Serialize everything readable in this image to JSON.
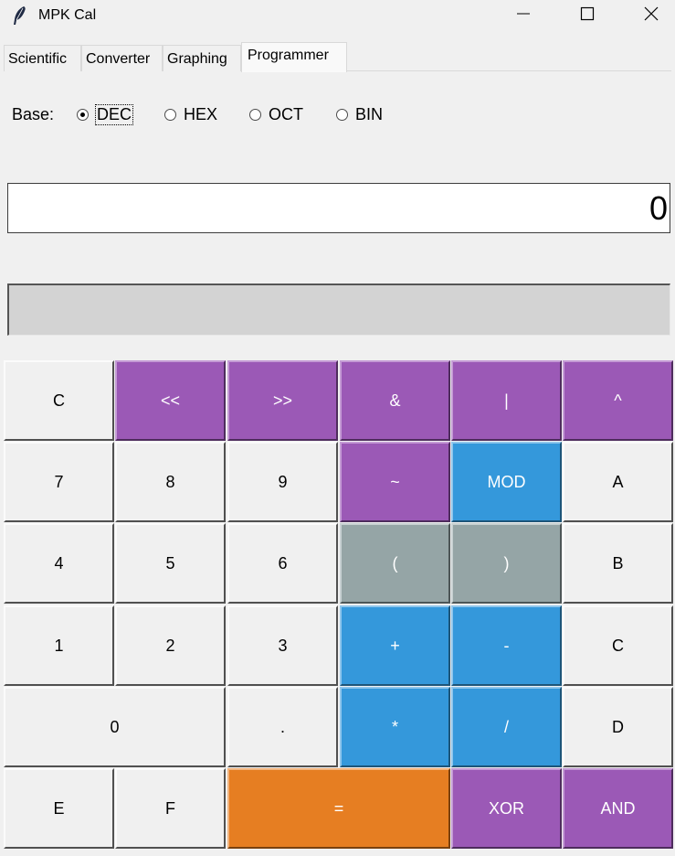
{
  "window": {
    "title": "MPK Cal",
    "icon": "feather-icon",
    "controls": [
      "minimize-icon",
      "maximize-icon",
      "close-icon"
    ]
  },
  "tabs": [
    {
      "label": "Scientific",
      "active": false
    },
    {
      "label": "Converter",
      "active": false
    },
    {
      "label": "Graphing",
      "active": false
    },
    {
      "label": "Programmer",
      "active": true
    }
  ],
  "base": {
    "label": "Base:",
    "options": [
      {
        "label": "DEC",
        "checked": true
      },
      {
        "label": "HEX",
        "checked": false
      },
      {
        "label": "OCT",
        "checked": false
      },
      {
        "label": "BIN",
        "checked": false
      }
    ]
  },
  "display": {
    "value": "0",
    "history": ""
  },
  "colors": {
    "purple": "#9b59b6",
    "blue": "#3498db",
    "gray": "#95a5a6",
    "orange": "#e67e22",
    "light": "#f0f0f0"
  },
  "keys": [
    {
      "label": "C",
      "style": "light"
    },
    {
      "label": "<<",
      "style": "purple"
    },
    {
      "label": ">>",
      "style": "purple"
    },
    {
      "label": "&",
      "style": "purple"
    },
    {
      "label": "|",
      "style": "purple"
    },
    {
      "label": "^",
      "style": "purple"
    },
    {
      "label": "7",
      "style": "light"
    },
    {
      "label": "8",
      "style": "light"
    },
    {
      "label": "9",
      "style": "light"
    },
    {
      "label": "~",
      "style": "purple"
    },
    {
      "label": "MOD",
      "style": "blue"
    },
    {
      "label": "A",
      "style": "light"
    },
    {
      "label": "4",
      "style": "light"
    },
    {
      "label": "5",
      "style": "light"
    },
    {
      "label": "6",
      "style": "light"
    },
    {
      "label": "(",
      "style": "gray"
    },
    {
      "label": ")",
      "style": "gray"
    },
    {
      "label": "B",
      "style": "light"
    },
    {
      "label": "1",
      "style": "light"
    },
    {
      "label": "2",
      "style": "light"
    },
    {
      "label": "3",
      "style": "light"
    },
    {
      "label": "+",
      "style": "blue"
    },
    {
      "label": "-",
      "style": "blue"
    },
    {
      "label": "C",
      "style": "light"
    },
    {
      "label": "0",
      "style": "light"
    },
    {
      "label": ".",
      "style": "light"
    },
    {
      "label": "*",
      "style": "blue"
    },
    {
      "label": "/",
      "style": "blue"
    },
    {
      "label": "D",
      "style": "light"
    },
    {
      "label": "E",
      "style": "light"
    },
    {
      "label": "F",
      "style": "light"
    },
    {
      "label": "=",
      "style": "orange"
    },
    {
      "label": "XOR",
      "style": "purple"
    },
    {
      "label": "AND",
      "style": "purple"
    }
  ]
}
